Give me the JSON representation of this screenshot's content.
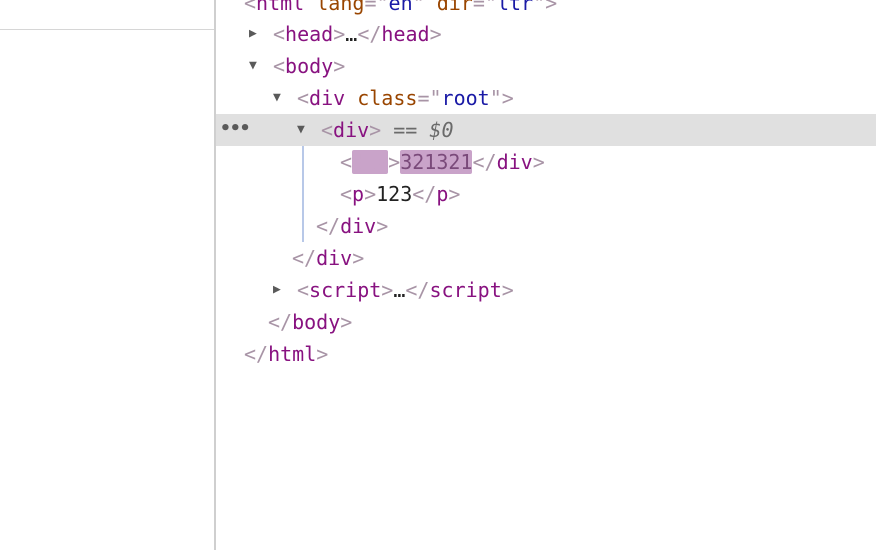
{
  "dom_tree": {
    "html_open": {
      "tag": "html",
      "attr1_name": "lang",
      "attr1_value": "en",
      "attr2_name": "dir",
      "attr2_value": "ltr"
    },
    "head": {
      "tag": "head",
      "collapsed_text": "…",
      "close_tag": "head"
    },
    "body": {
      "tag": "body"
    },
    "root_div": {
      "tag": "div",
      "attr_name": "class",
      "attr_value": "root"
    },
    "selected_div": {
      "tag": "div",
      "equals": "==",
      "console_ref": "$0",
      "ellipsis": "•••"
    },
    "inner_div": {
      "tag": "div",
      "text": "321321",
      "close_tag": "div"
    },
    "p": {
      "tag": "p",
      "text": "123",
      "close_tag": "p"
    },
    "selected_div_close": {
      "tag": "div"
    },
    "root_div_close": {
      "tag": "div"
    },
    "script": {
      "tag": "script",
      "collapsed_text": "…",
      "close_tag": "script"
    },
    "body_close": {
      "tag": "body"
    },
    "html_close": {
      "tag": "html"
    }
  },
  "colors": {
    "tag": "#881280",
    "punctuation": "#a894a6",
    "attribute_name": "#994500",
    "attribute_value": "#1a1aa6",
    "selected_row": "#e0e0e0",
    "search_highlight": "#c9a3c9"
  }
}
